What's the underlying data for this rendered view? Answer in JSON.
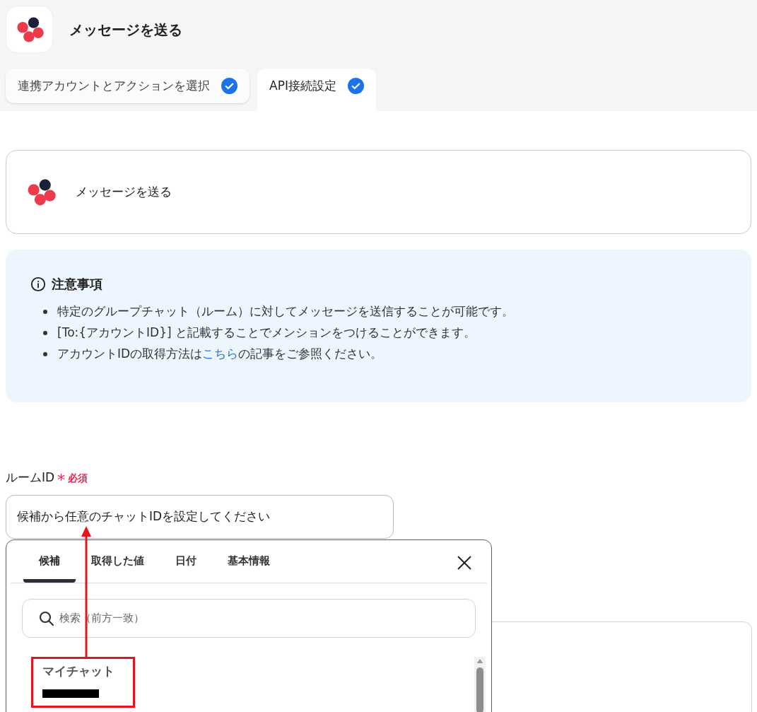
{
  "header": {
    "title": "メッセージを送る"
  },
  "steps": [
    {
      "label": "連携アカウントとアクションを選択",
      "selected": false,
      "done": true
    },
    {
      "label": "API接続設定",
      "selected": true,
      "done": true
    }
  ],
  "action_card": {
    "title": "メッセージを送る"
  },
  "notice": {
    "title": "注意事項",
    "items": [
      {
        "text": "特定のグループチャット（ルーム）に対してメッセージを送信することが可能です。"
      },
      {
        "text": "[To:{アカウントID}] と記載することでメンションをつけることができます。"
      },
      {
        "text": "アカウントIDの取得方法は",
        "link": "こちら",
        "after": "の記事をご参照ください。"
      }
    ]
  },
  "room_field": {
    "label": "ルームID",
    "asterisk": "*",
    "required": "必須",
    "value": "候補から任意のチャットIDを設定してください"
  },
  "picker": {
    "tabs": [
      {
        "label": "候補",
        "selected": true
      },
      {
        "label": "取得した値",
        "selected": false
      },
      {
        "label": "日付",
        "selected": false
      },
      {
        "label": "基本情報",
        "selected": false
      }
    ],
    "search": {
      "placeholder": "検索（前方一致）"
    },
    "items": [
      {
        "name": "マイチャット"
      }
    ]
  }
}
